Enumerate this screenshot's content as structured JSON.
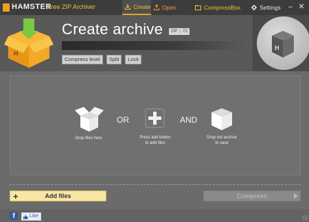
{
  "app": {
    "brand": "HAMSTER",
    "product": "Free ZIP Archiver"
  },
  "nav": {
    "create": "Create",
    "open": "Open",
    "compressbox": "CompressBox",
    "settings": "Settings"
  },
  "window": {
    "minimize": "–",
    "close": "✕"
  },
  "header": {
    "title": "Create archive",
    "formats": [
      "ZIP",
      "7Z"
    ],
    "format_sep": "|",
    "options": [
      "Compress level",
      "Split",
      "Lock"
    ]
  },
  "dropzone": {
    "drop_files": "Drop files here",
    "or": "OR",
    "press_add": "Press add button\nto add files",
    "and": "AND",
    "drop_out": "Drop out archive\nto save"
  },
  "actions": {
    "add_files": "Add files",
    "add_plus": "+",
    "compress": "Compress"
  },
  "footer": {
    "fb": "f",
    "like": "Like"
  },
  "colors": {
    "accent": "#f2c230",
    "open_accent": "#f29c2a",
    "box": "#f0a020",
    "add_button": "#f7e6a4"
  }
}
